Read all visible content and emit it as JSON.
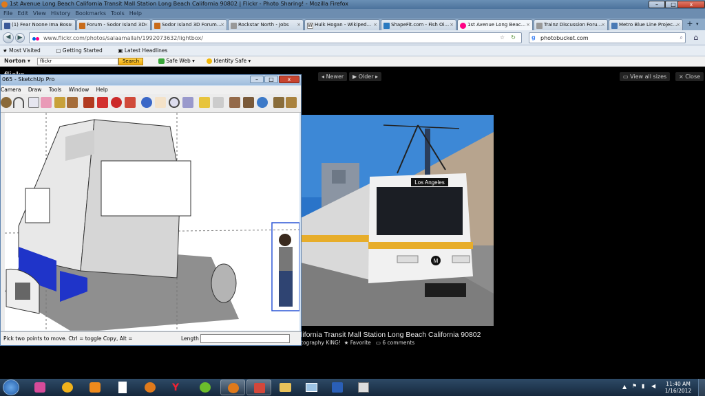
{
  "window": {
    "title": "1st Avenue Long Beach California Transit Mall Station Long Beach California 90802 | Flickr - Photo Sharing! - Mozilla Firefox",
    "min": "–",
    "max": "□",
    "close": "x"
  },
  "menu": [
    "File",
    "Edit",
    "View",
    "History",
    "Bookmarks",
    "Tools",
    "Help"
  ],
  "tabs": [
    {
      "label": "(1) Fear Noone Ima Boss",
      "icon": "facebook-icon",
      "color": "#3b5998"
    },
    {
      "label": "Forum - Sodor Island 3D",
      "icon": "forum-icon",
      "color": "#c86b1a"
    },
    {
      "label": "Sodor Island 3D Forum...",
      "icon": "forum-icon",
      "color": "#c86b1a"
    },
    {
      "label": "Rockstar North - Jobs",
      "icon": "page-icon",
      "color": "#999999"
    },
    {
      "label": "Hulk Hogan - Wikiped...",
      "icon": "wikipedia-icon",
      "color": "#ffffff"
    },
    {
      "label": "ShapeFit.com - Fish Oi...",
      "icon": "shapefit-icon",
      "color": "#2a7ac0"
    },
    {
      "label": "1st Avenue Long Beac...",
      "icon": "flickr-icon",
      "color": "#ff0084"
    },
    {
      "label": "Trainz Discussion Foru...",
      "icon": "page-icon",
      "color": "#999999"
    },
    {
      "label": "Metro Blue Line Projec...",
      "icon": "page-icon",
      "color": "#4a7ab5"
    }
  ],
  "nav": {
    "url": "www.flickr.com/photos/salaamallah/1992073632/lightbox/",
    "search": "photobucket.com"
  },
  "bookmarks": [
    "Most Visited",
    "Getting Started",
    "Latest Headlines"
  ],
  "norton": {
    "brand": "Norton",
    "search_value": "flickr",
    "search_button": "Search",
    "safeweb": "Safe Web",
    "identity": "Identity Safe"
  },
  "lightbox": {
    "newer": "Newer",
    "older": "Older",
    "view_sizes": "View all sizes",
    "close": "Close",
    "caption": "lifornia Transit Mall Station Long Beach California 90802",
    "sub_author": "tography KING!",
    "favorite": "Favorite",
    "comments": "6 comments",
    "sign_text": "Los Angeles"
  },
  "sketchup": {
    "title": "065 - SketchUp Pro",
    "menu": [
      "Camera",
      "Draw",
      "Tools",
      "Window",
      "Help"
    ],
    "status": "Pick two points to move.  Ctrl = toggle Copy, Alt =",
    "length_label": "Length"
  },
  "clock": {
    "time": "11:40 AM",
    "date": "1/16/2012"
  }
}
